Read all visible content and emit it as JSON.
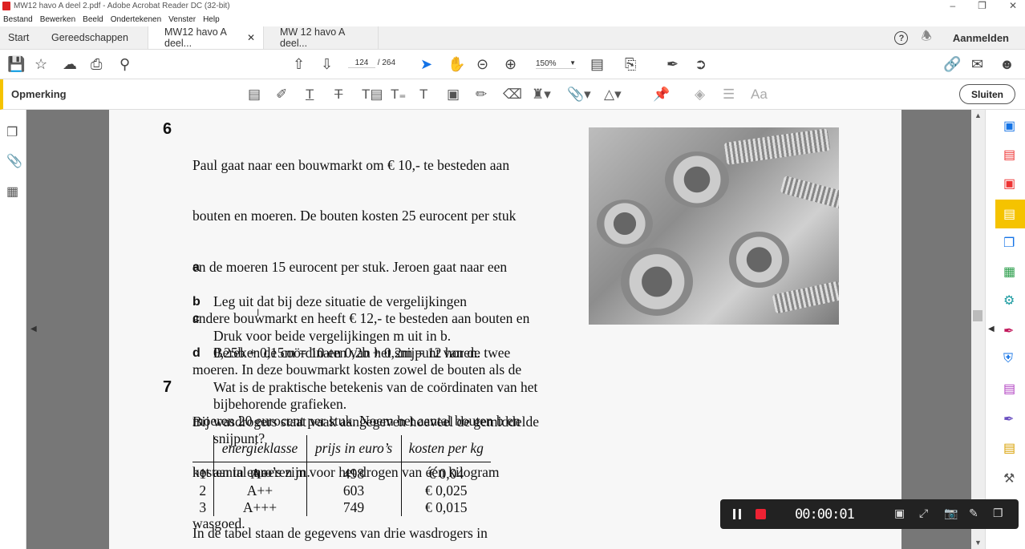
{
  "window": {
    "title": "MW12 havo A deel 2.pdf - Adobe Acrobat Reader DC (32-bit)"
  },
  "menu": [
    "Bestand",
    "Bewerken",
    "Beeld",
    "Ondertekenen",
    "Venster",
    "Help"
  ],
  "tabs": {
    "home": "Start",
    "tools": "Gereedschappen",
    "doc1": "MW12 havo A deel...",
    "doc2": "MW 12 havo A deel..."
  },
  "header": {
    "signin": "Aanmelden",
    "help": "?"
  },
  "toolbar": {
    "page_current": "124",
    "page_total": "/ 264",
    "zoom": "150%"
  },
  "comment_bar": {
    "label": "Opmerking",
    "close": "Sluiten"
  },
  "document": {
    "q6": {
      "num": "6",
      "lines": [
        "Paul gaat naar een bouwmarkt om € 10,- te besteden aan",
        "bouten en moeren. De bouten kosten 25 eurocent per stuk",
        "en de moeren 15 eurocent per stuk. Jeroen gaat naar een",
        "andere bouwmarkt en heeft € 12,- te besteden aan bouten en",
        "moeren. In deze bouwmarkt kosten zowel de bouten als de",
        "moeren 20 eurocent per stuk. Noem het aantal bouten b en",
        "het aantal moeren m."
      ],
      "parts": [
        {
          "letter": "a",
          "lines": [
            "Leg uit dat bij deze situatie de vergelijkingen",
            "0,25b + 0,15m = 10 en 0,2b + 0,2m = 12 horen."
          ]
        },
        {
          "letter": "b",
          "lines": [
            "Druk voor beide vergelijkingen m uit in b."
          ]
        },
        {
          "letter": "c",
          "lines": [
            "Bereken de coördinaten van het snijpunt van de twee",
            "bijbehorende grafieken."
          ]
        },
        {
          "letter": "d",
          "lines": [
            "Wat is de praktische betekenis van de coördinaten van het",
            "snijpunt?"
          ]
        }
      ]
    },
    "q7": {
      "num": "7",
      "lines": [
        "Bij wasdrogers staat vaak aangegeven hoeveel de gemiddelde",
        "kosten in euro’s zijn voor het drogen van één kilogram",
        "wasgoed."
      ],
      "table": {
        "headers": [
          "",
          "energieklasse",
          "prijs in euro’s",
          "kosten per kg"
        ],
        "rows": [
          [
            "1",
            "A+",
            "498",
            "€ 0,04"
          ],
          [
            "2",
            "A++",
            "603",
            "€ 0,025"
          ],
          [
            "3",
            "A+++",
            "749",
            "€ 0,015"
          ]
        ]
      },
      "after": "In de tabel staan de gegevens van drie wasdrogers in"
    }
  },
  "recorder": {
    "time": "00:00:01"
  }
}
